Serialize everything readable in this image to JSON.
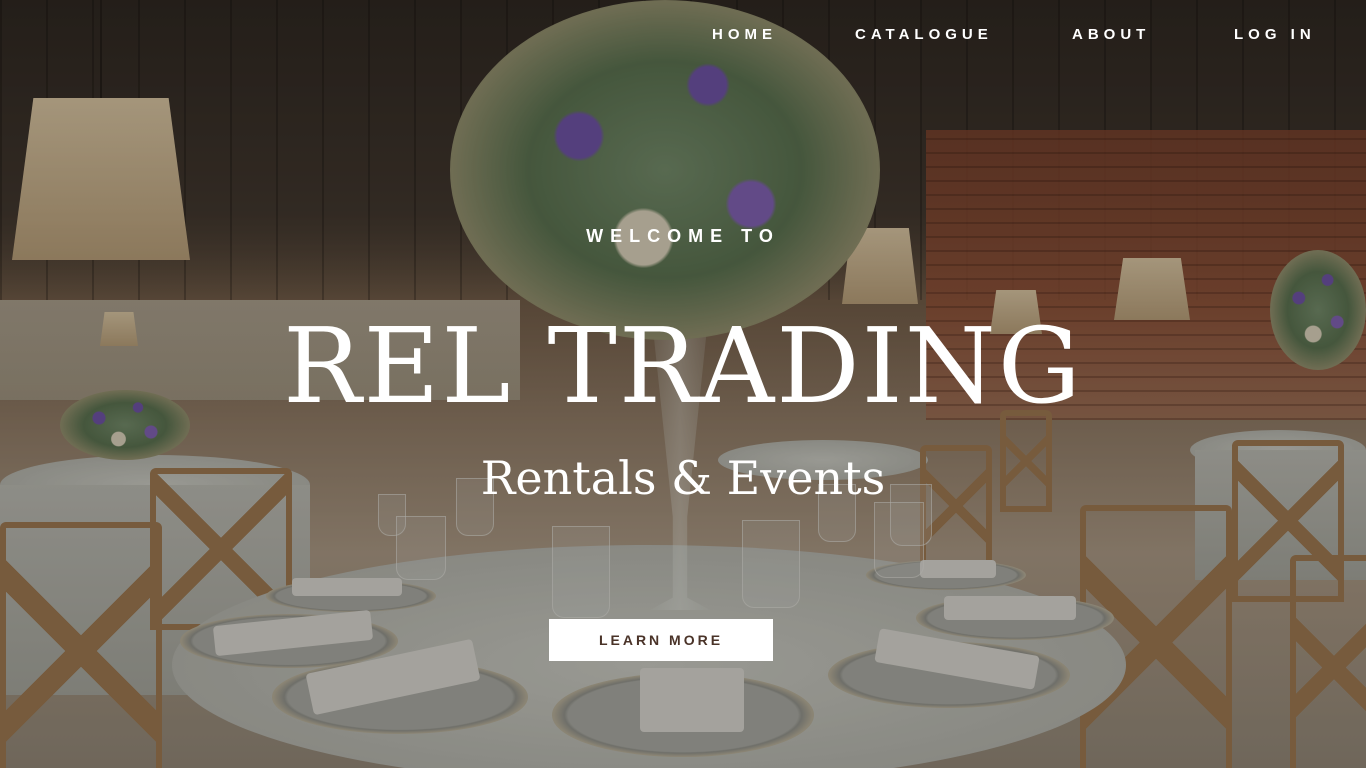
{
  "nav": {
    "home": "HOME",
    "catalogue": "CATALOGUE",
    "about": "ABOUT",
    "login": "LOG IN"
  },
  "hero": {
    "welcome": "WELCOME TO",
    "brand": "REL TRADING",
    "tagline": "Rentals & Events",
    "cta_label": "LEARN MORE"
  },
  "colors": {
    "cta_background": "#ffffff",
    "cta_text": "#4a3328",
    "text": "#ffffff"
  }
}
